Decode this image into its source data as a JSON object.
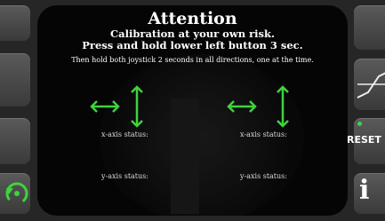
{
  "header": {
    "title": "Attention",
    "warning": "Calibration at your own risk.",
    "instruction": "Press and hold lower left button 3 sec.",
    "subinstruction": "Then hold both joystick 2 seconds in all directions, one at the time."
  },
  "left_joystick": {
    "x_status_label": "x-axis status:",
    "y_status_label": "y-axis status:"
  },
  "right_joystick": {
    "x_status_label": "x-axis status:",
    "y_status_label": "y-axis status:"
  },
  "right_panel": {
    "reset_label": "RESET",
    "info_label": "i"
  },
  "colors": {
    "accent": "#3fd33f",
    "text": "#ffffff",
    "screen_bg": "#050505"
  }
}
